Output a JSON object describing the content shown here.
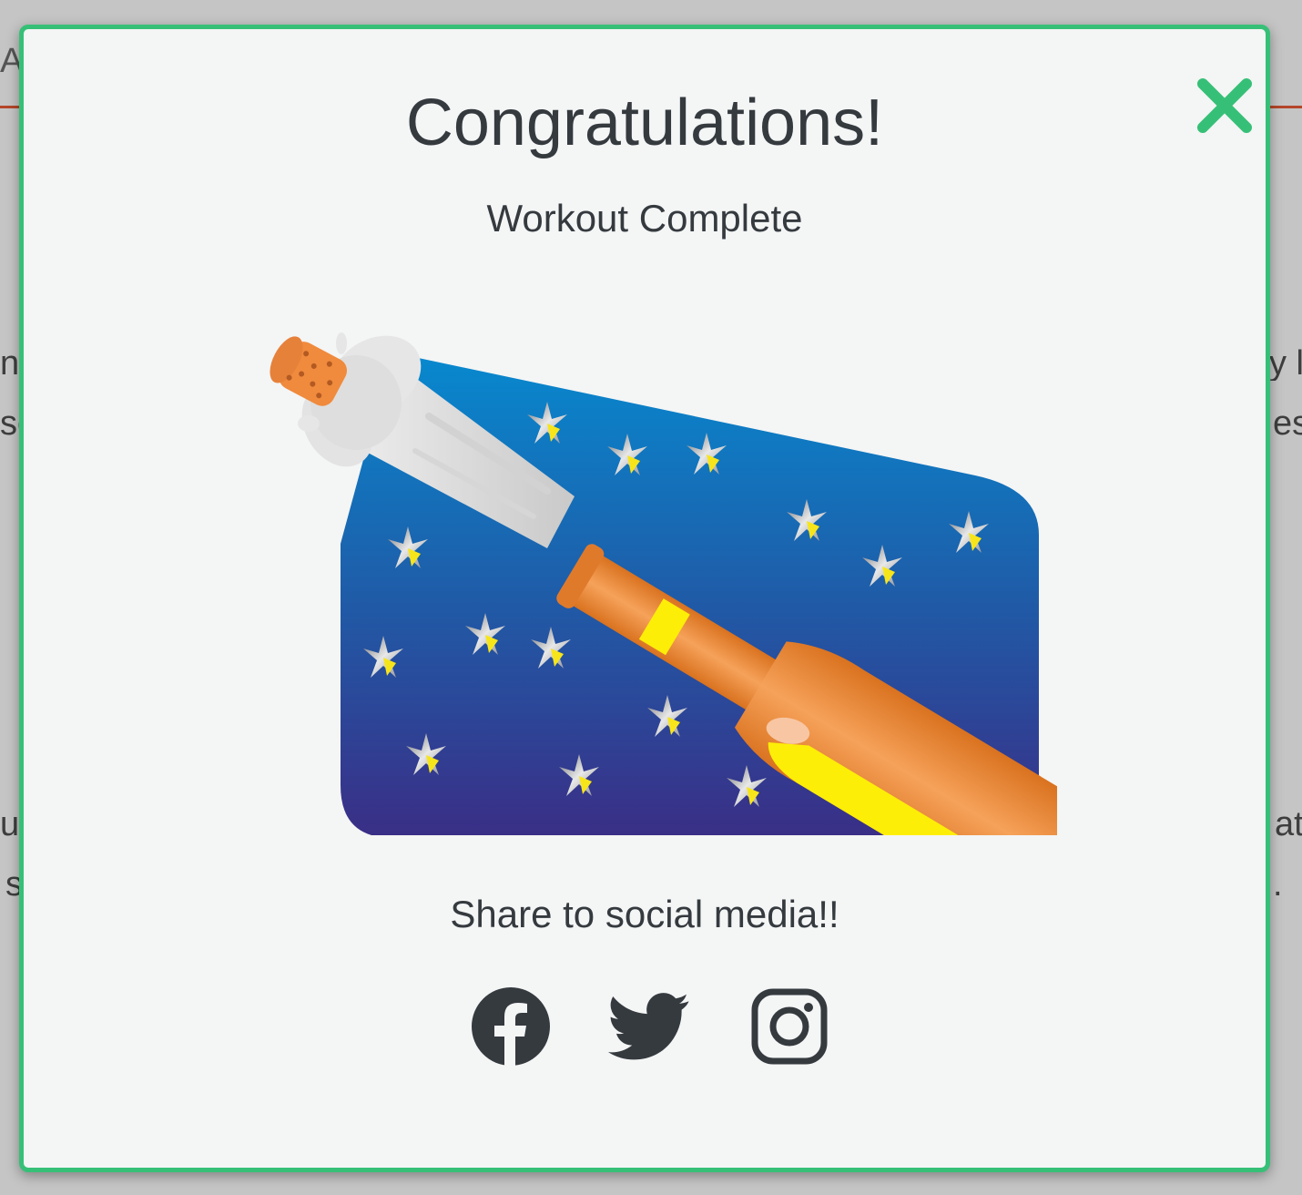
{
  "modal": {
    "title": "Congratulations!",
    "subtitle": "Workout Complete",
    "share_text": "Share to social media!!",
    "icons": {
      "close": "close-x-icon",
      "facebook": "facebook-icon",
      "twitter": "twitter-icon",
      "instagram": "instagram-icon",
      "illustration": "champagne-bottle-illustration"
    }
  },
  "colors": {
    "accent_green": "#36c077",
    "text_dark": "#353a3f",
    "modal_bg": "#f4f5f5",
    "page_bg": "#c5c5c5"
  },
  "background_fragments": {
    "f1": "Ac",
    "f2": "n",
    "f3": "se",
    "f4": "u",
    "f5": "s",
    "f6": "y l",
    "f7": "es",
    "f8": "at",
    "f9": "."
  }
}
